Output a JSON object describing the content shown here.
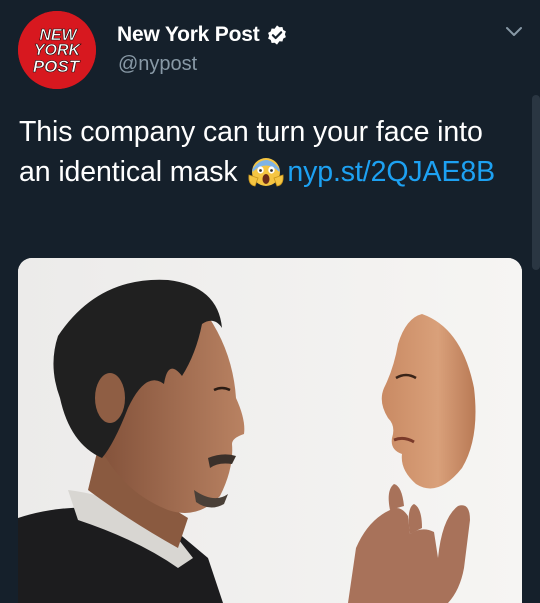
{
  "account": {
    "display_name": "New York Post",
    "handle": "@nypost",
    "verified": true,
    "avatar_logo_lines": [
      "NEW",
      "YORK",
      "POST"
    ]
  },
  "tweet": {
    "text_part1": "This company can turn your face into an identical mask ",
    "emoji": "face-screaming-in-fear",
    "link_text": "nyp.st/2QJAE8B"
  },
  "media": {
    "description_icon": "photo-man-holding-face-mask"
  },
  "colors": {
    "background": "#15202b",
    "link": "#1da1f2",
    "secondary_text": "#8899a6",
    "brand_red": "#d7181f"
  }
}
